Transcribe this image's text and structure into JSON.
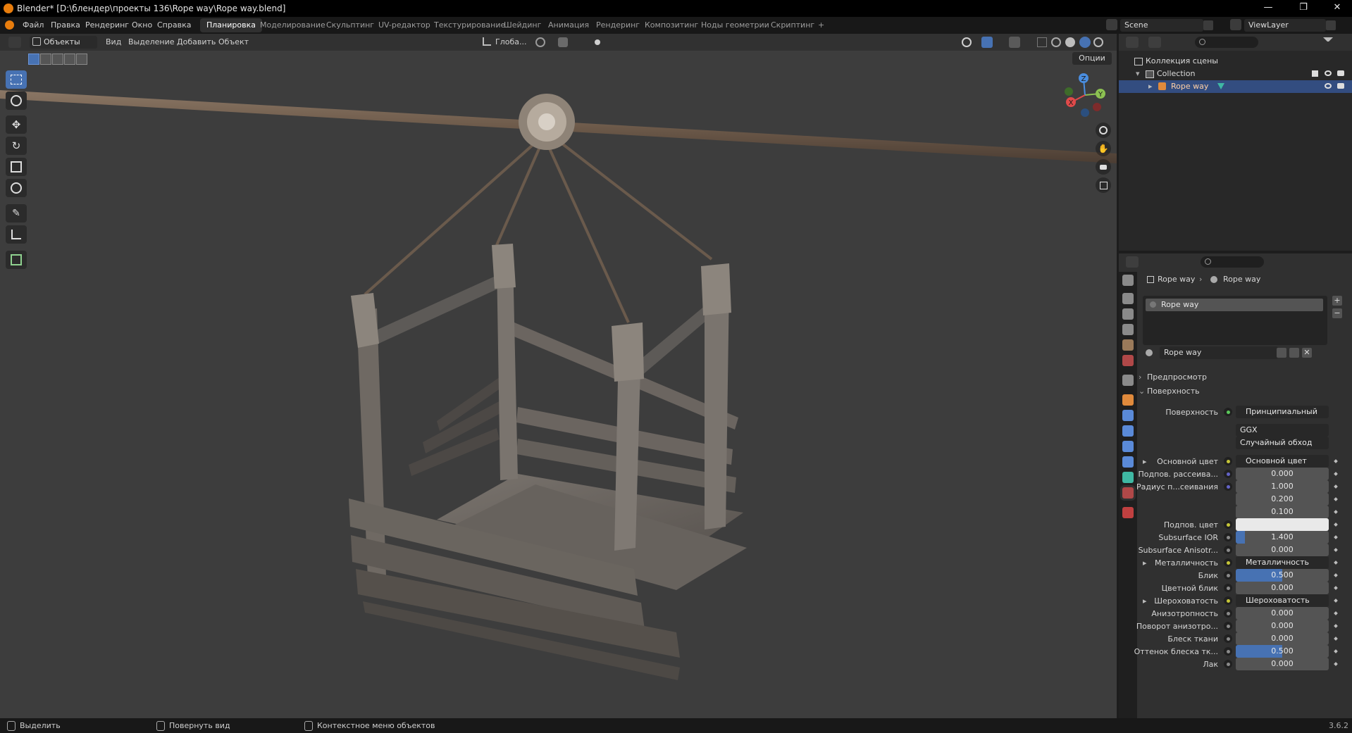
{
  "window": {
    "title": "Blender* [D:\\блендер\\проекты 136\\Rope way\\Rope way.blend]",
    "controls": [
      "—",
      "❐",
      "✕"
    ]
  },
  "menu": [
    "Файл",
    "Правка",
    "Рендеринг",
    "Окно",
    "Справка"
  ],
  "workspaces": [
    "Планировка",
    "Моделирование",
    "Скульптинг",
    "UV-редактор",
    "Текстурирование",
    "Шейдинг",
    "Анимация",
    "Рендеринг",
    "Композитинг",
    "Ноды геометрии",
    "Скриптинг",
    "+"
  ],
  "active_workspace": "Планировка",
  "scene": {
    "name": "Scene",
    "view_layer": "ViewLayer"
  },
  "viewport_header": {
    "mode": "Объекты",
    "menus": [
      "Вид",
      "Выделение",
      "Добавить",
      "Объект"
    ],
    "orientation": "Глоба...",
    "options": "Опции"
  },
  "gizmo": {
    "x": "X",
    "y": "Y",
    "z": "Z"
  },
  "outliner": {
    "root": "Коллекция сцены",
    "collection": "Collection",
    "object": "Rope way"
  },
  "properties": {
    "breadcrumb_object": "Rope way",
    "breadcrumb_material": "Rope way",
    "material_slot": "Rope way",
    "material_name": "Rope way",
    "sections": {
      "preview": "Предпросмотр",
      "surface": "Поверхность"
    },
    "surface_label": "Поверхность",
    "surface_shader": "Принципиальный BSDF",
    "distribution": "GGX",
    "subsurface_method": "Случайный обход",
    "rows": [
      {
        "label": "Основной цвет",
        "value": "Основной цвет",
        "kind": "link"
      },
      {
        "label": "Подпов. рассеива...",
        "value": "0.000",
        "kind": "num"
      },
      {
        "label": "Радиус п...сеивания",
        "value": "1.000",
        "kind": "num"
      },
      {
        "label": "",
        "value": "0.200",
        "kind": "num"
      },
      {
        "label": "",
        "value": "0.100",
        "kind": "num"
      },
      {
        "label": "Подпов. цвет",
        "value": "",
        "kind": "color"
      },
      {
        "label": "Subsurface IOR",
        "value": "1.400",
        "kind": "num"
      },
      {
        "label": "Subsurface Anisotr...",
        "value": "0.000",
        "kind": "num"
      },
      {
        "label": "Металличность",
        "value": "Металличность",
        "kind": "link"
      },
      {
        "label": "Блик",
        "value": "0.500",
        "kind": "blue"
      },
      {
        "label": "Цветной блик",
        "value": "0.000",
        "kind": "num"
      },
      {
        "label": "Шероховатость",
        "value": "Шероховатость",
        "kind": "link"
      },
      {
        "label": "Анизотропность",
        "value": "0.000",
        "kind": "num"
      },
      {
        "label": "Поворот анизотро...",
        "value": "0.000",
        "kind": "num"
      },
      {
        "label": "Блеск ткани",
        "value": "0.000",
        "kind": "num"
      },
      {
        "label": "Оттенок блеска тк...",
        "value": "0.500",
        "kind": "blue"
      },
      {
        "label": "Лак",
        "value": "0.000",
        "kind": "num"
      }
    ],
    "subsurface_ior_fill": 0.1,
    "specular_fill": 0.5,
    "sheen_tint_fill": 0.5
  },
  "status": {
    "select": "Выделить",
    "rotate": "Повернуть вид",
    "context": "Контекстное меню объектов",
    "version": "3.6.2"
  }
}
